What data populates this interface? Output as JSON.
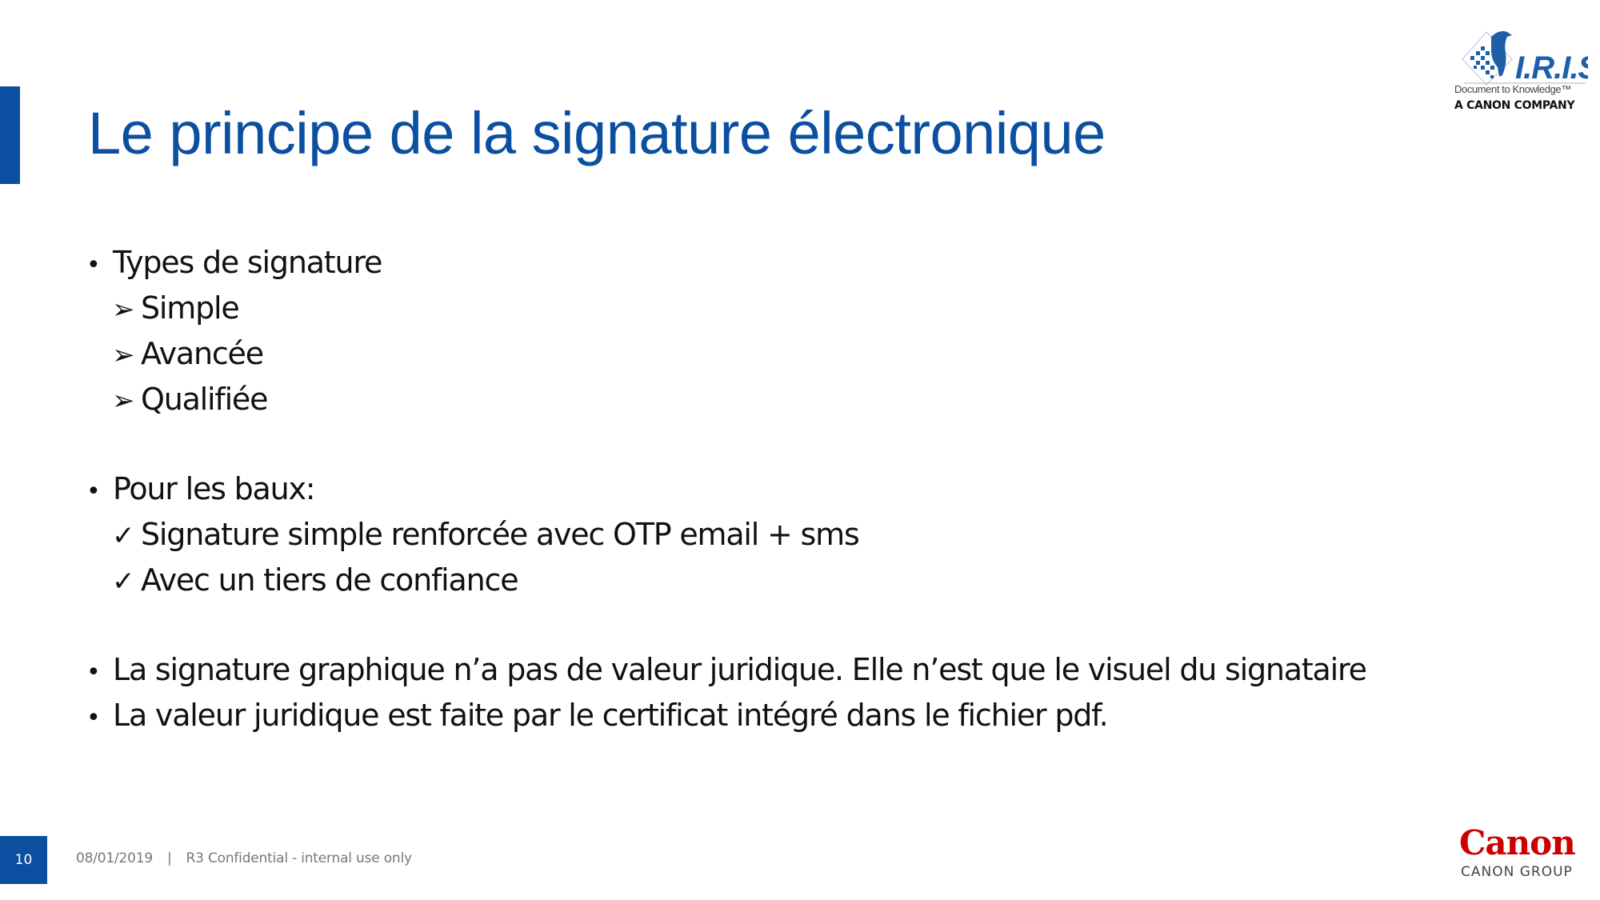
{
  "slide": {
    "title": "Le principe de la signature électronique",
    "page_number": "10",
    "footer": {
      "date": "08/01/2019",
      "separator": "|",
      "confidentiality": "R3 Confidential - internal use only"
    }
  },
  "content": {
    "section1": {
      "bullet": "•",
      "text": "Types de signature",
      "items": [
        {
          "mark": "➢",
          "text": "Simple"
        },
        {
          "mark": "➢",
          "text": "Avancée"
        },
        {
          "mark": "➢",
          "text": "Qualifiée"
        }
      ]
    },
    "section2": {
      "bullet": "•",
      "text": "Pour les baux:",
      "items": [
        {
          "mark": "✓",
          "text": "Signature simple renforcée avec OTP email + sms"
        },
        {
          "mark": "✓",
          "text": "Avec un tiers de confiance"
        }
      ]
    },
    "section3": [
      {
        "bullet": "•",
        "text": "La signature graphique n’a pas de valeur juridique. Elle n’est que le visuel du signataire"
      },
      {
        "bullet": "•",
        "text": "La valeur juridique est faite par le certificat intégré dans le fichier pdf."
      }
    ]
  },
  "logos": {
    "iris": {
      "name": "I.R.I.S.",
      "tagline": "Document to Knowledge™",
      "company": "A CANON COMPANY"
    },
    "canon": {
      "name": "Canon",
      "group": "CANON GROUP"
    }
  },
  "colors": {
    "brand_blue": "#0b4fa0",
    "canon_red": "#cc0000"
  }
}
